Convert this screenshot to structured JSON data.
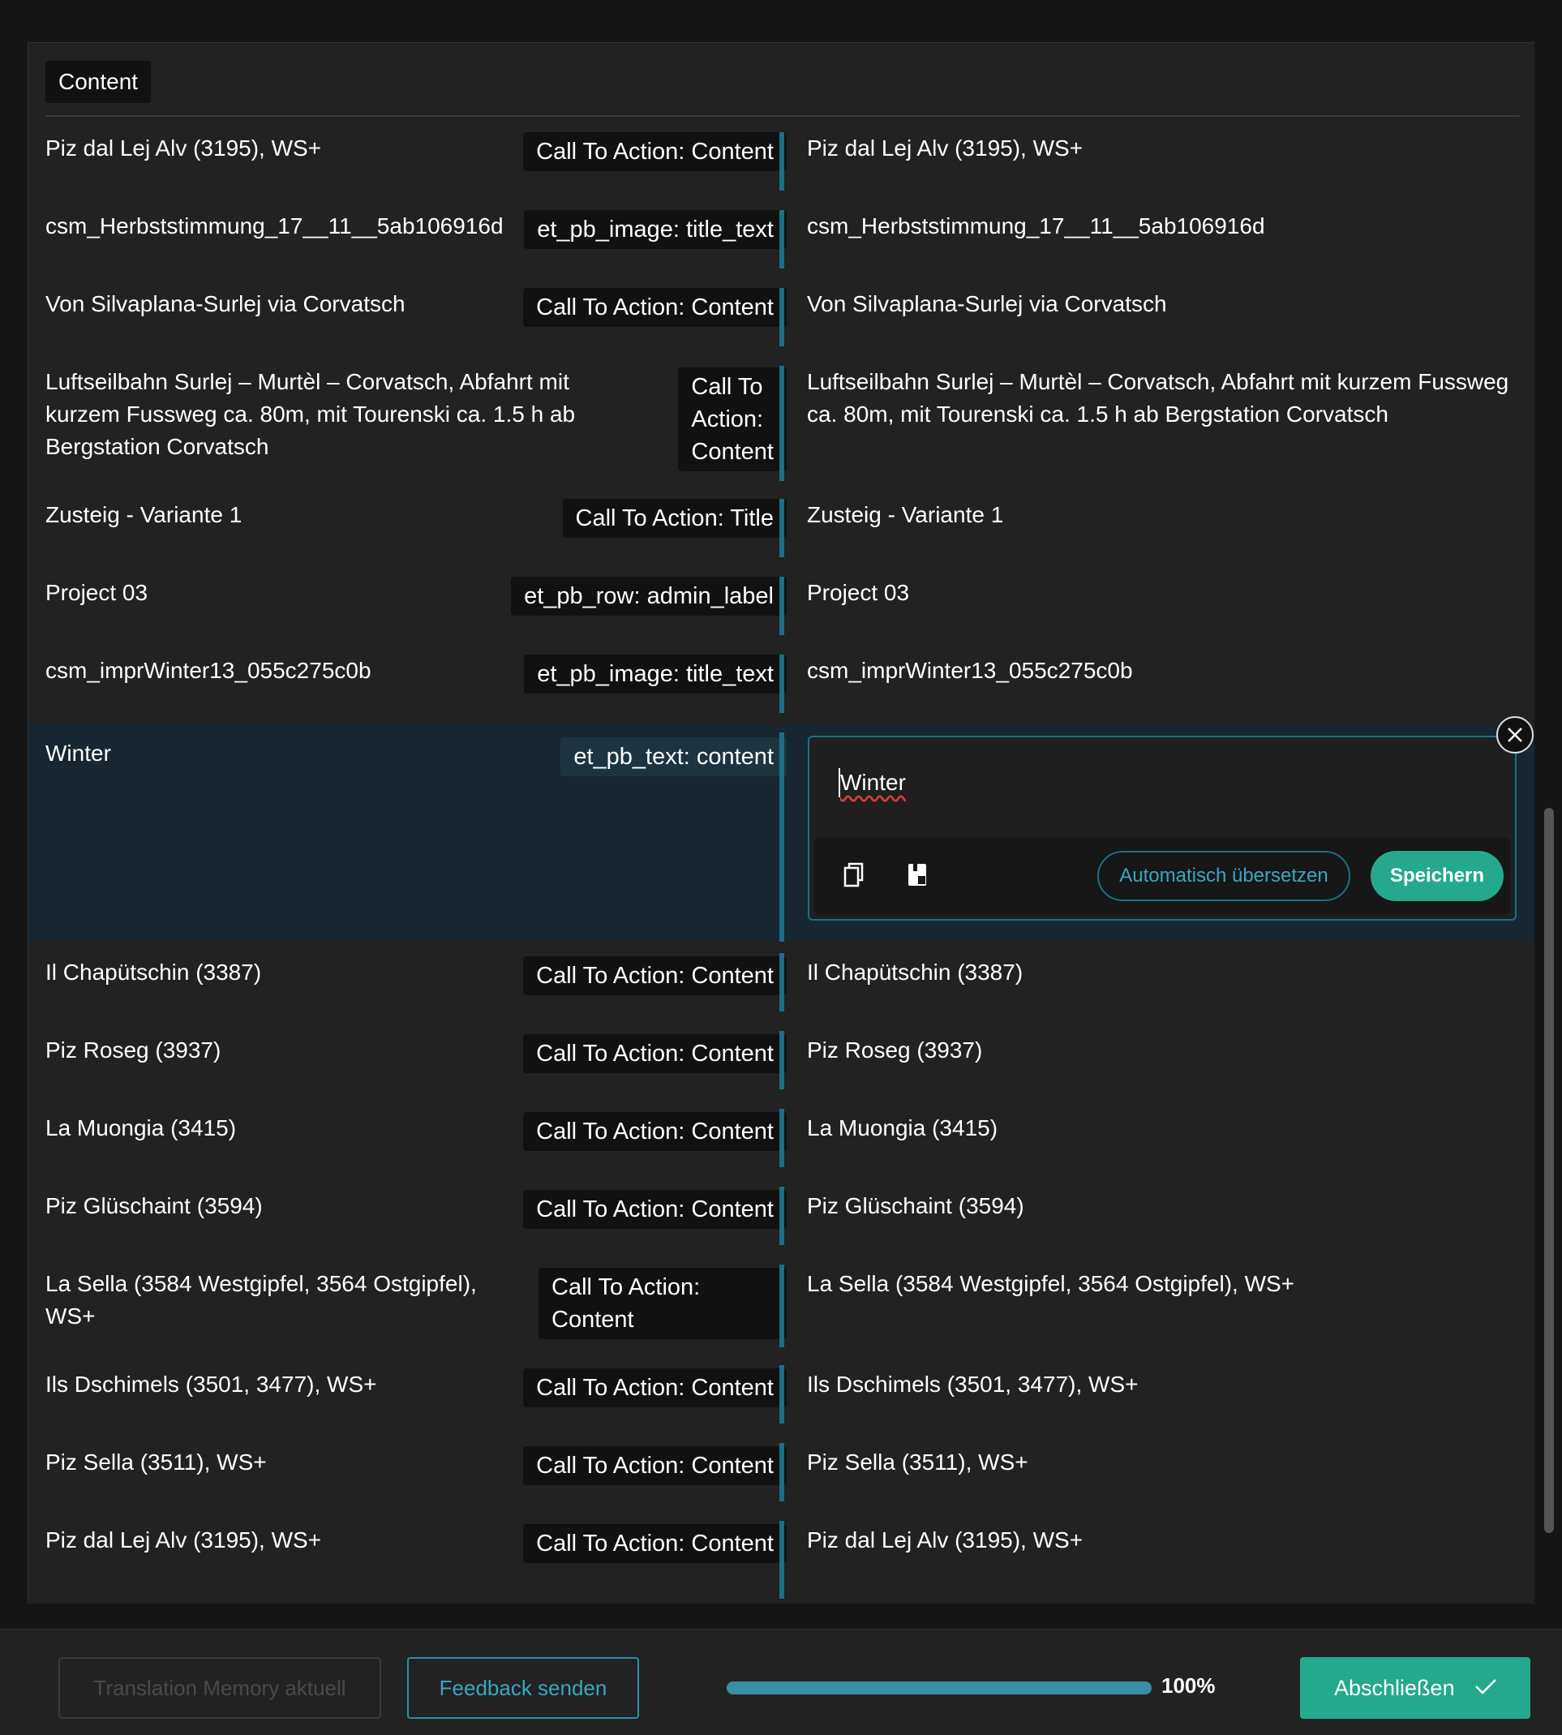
{
  "panel": {
    "header_label": "Content"
  },
  "rows": [
    {
      "source": "Piz dal Lej Alv (3195), WS+",
      "tag": "Call To Action: Content",
      "target": "Piz dal Lej Alv (3195), WS+"
    },
    {
      "source": "csm_Herbststimmung_17__11__5ab106916d",
      "tag": "et_pb_image: title_text",
      "target": "csm_Herbststimmung_17__11__5ab106916d"
    },
    {
      "source": "Von Silvaplana-Surlej via Corvatsch",
      "tag": "Call To Action: Content",
      "target": "Von Silvaplana-Surlej via Corvatsch"
    },
    {
      "source_lines": [
        "Luftseilbahn Surlej – Murtèl – Corvatsch, Abfahrt mit",
        "kurzem Fussweg ca. 80m, mit Tourenski ca. 1.5 h ab",
        "Bergstation Corvatsch"
      ],
      "tag_lines": [
        "Call To",
        "Action:",
        "Content"
      ],
      "target_lines": [
        "Luftseilbahn Surlej – Murtèl – Corvatsch, Abfahrt mit kurzem Fussweg",
        "ca. 80m, mit Tourenski ca. 1.5 h ab Bergstation Corvatsch"
      ]
    },
    {
      "source": "Zusteig - Variante 1",
      "tag": "Call To Action: Title",
      "target": "Zusteig - Variante 1"
    },
    {
      "source": "Project 03",
      "tag": "et_pb_row: admin_label",
      "target": "Project 03"
    },
    {
      "source": "csm_imprWinter13_055c275c0b",
      "tag": "et_pb_image: title_text",
      "target": "csm_imprWinter13_055c275c0b"
    },
    {
      "source": "Winter",
      "tag": "et_pb_text: content",
      "target": "Winter"
    },
    {
      "source": "Il Chapütschin (3387)",
      "tag": "Call To Action: Content",
      "target": "Il Chapütschin (3387)"
    },
    {
      "source": "Piz Roseg (3937)",
      "tag": "Call To Action: Content",
      "target": "Piz Roseg (3937)"
    },
    {
      "source": "La Muongia (3415)",
      "tag": "Call To Action: Content",
      "target": "La Muongia (3415)"
    },
    {
      "source": "Piz Glüschaint (3594)",
      "tag": "Call To Action: Content",
      "target": "Piz Glüschaint (3594)"
    },
    {
      "source_lines": [
        "La Sella (3584 Westgipfel, 3564 Ostgipfel),",
        "WS+"
      ],
      "tag_lines": [
        "Call To Action:",
        "Content"
      ],
      "target": "La Sella (3584 Westgipfel, 3564 Ostgipfel), WS+"
    },
    {
      "source": "Ils Dschimels (3501, 3477), WS+",
      "tag": "Call To Action: Content",
      "target": "Ils Dschimels (3501, 3477), WS+"
    },
    {
      "source": "Piz Sella (3511), WS+",
      "tag": "Call To Action: Content",
      "target": "Piz Sella (3511), WS+"
    },
    {
      "source": "Piz dal Lej Alv (3195), WS+",
      "tag": "Call To Action: Content",
      "target": "Piz dal Lej Alv (3195), WS+"
    }
  ],
  "editor": {
    "value": "Winter",
    "auto_translate_label": "Automatisch übersetzen",
    "save_label": "Speichern",
    "copy_icon": "copy-icon",
    "glossary_icon": "glossary-icon",
    "close_icon": "close-icon"
  },
  "footer": {
    "tm_label": "Translation Memory aktuell",
    "feedback_label": "Feedback senden",
    "progress_percent": 100,
    "progress_label": "100%",
    "finish_label": "Abschließen"
  },
  "colors": {
    "accent_teal": "#25a98c",
    "accent_blue": "#1c6f87",
    "background": "#222222",
    "active_row": "#172630"
  }
}
